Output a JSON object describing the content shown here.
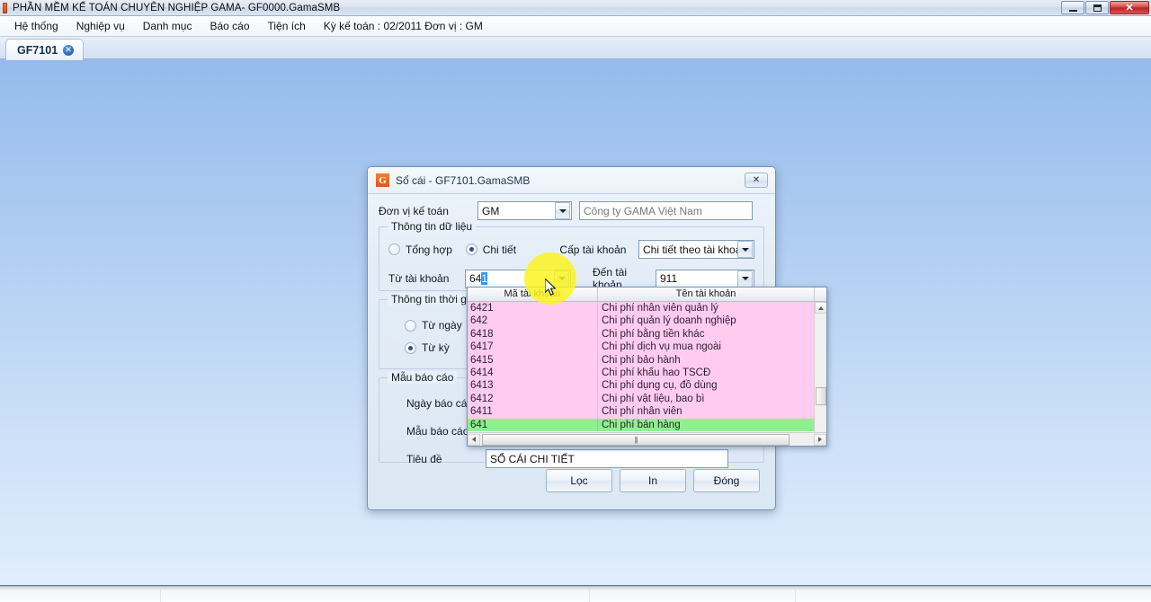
{
  "window": {
    "title": "PHẦN MỀM KẾ TOÁN CHUYÊN NGHIỆP GAMA- GF0000.GamaSMB",
    "minimize_label": "",
    "maximize_label": "",
    "close_label": "✕"
  },
  "menubar": {
    "items": [
      {
        "label": "Hệ thống"
      },
      {
        "label": "Nghiệp vụ"
      },
      {
        "label": "Danh mục"
      },
      {
        "label": "Báo cáo"
      },
      {
        "label": "Tiện ích"
      }
    ],
    "status": "Kỳ kế toán : 02/2011 Đơn vị : GM"
  },
  "tabs": [
    {
      "label": "GF7101",
      "close": "✕"
    }
  ],
  "dialog": {
    "logo_text": "G",
    "title": "Sổ cái - GF7101.GamaSMB",
    "close_label": "✕",
    "unit_label": "Đơn vị kế toán",
    "unit_value": "GM",
    "unit_name": "Công ty GAMA Việt Nam",
    "data_group_caption": "Thông tin dữ liệu",
    "radio_summary": "Tổng hợp",
    "radio_detail": "Chi tiết",
    "level_label": "Cấp tài khoản",
    "level_value": "Chi tiết theo tài khoản",
    "from_account_label": "Từ tài khoản",
    "from_account_value": "64",
    "from_account_selected": "1",
    "to_account_label": "Đến tài khoản",
    "to_account_value": "911",
    "time_group_caption": "Thông tin thời gian",
    "radio_from_date": "Từ ngày",
    "radio_from_period": "Từ kỳ",
    "report_group_caption": "Mẫu báo cáo",
    "report_date_label": "Ngày báo cáo",
    "report_template_label": "Mẫu báo cáo",
    "title_label": "Tiêu đề",
    "title_value": "SỔ CÁI CHI TIẾT",
    "buttons": [
      {
        "label": "Lọc"
      },
      {
        "label": "In"
      },
      {
        "label": "Đóng"
      }
    ]
  },
  "account_dropdown": {
    "columns": [
      "Mã tài khoản",
      "Tên tài khoản"
    ],
    "selected_index": 0,
    "rows": [
      {
        "code": "641",
        "name": "Chi phí bán hàng"
      },
      {
        "code": "6411",
        "name": "Chi phí nhân viên"
      },
      {
        "code": "6412",
        "name": "Chi phí vật liệu, bao bì"
      },
      {
        "code": "6413",
        "name": "Chi phí dụng cụ, đồ dùng"
      },
      {
        "code": "6414",
        "name": "Chi phí khấu hao TSCĐ"
      },
      {
        "code": "6415",
        "name": "Chi phí bảo hành"
      },
      {
        "code": "6417",
        "name": "Chi phí dịch vụ mua ngoài"
      },
      {
        "code": "6418",
        "name": "Chi phí bằng tiền khác"
      },
      {
        "code": "642",
        "name": "Chi phí quản lý doanh nghiệp"
      },
      {
        "code": "6421",
        "name": "Chi phí nhân viên quản lý"
      }
    ]
  },
  "colors": {
    "row_selected": "#8ff08f",
    "row_normal": "#ffccf0",
    "highlight": "#fcf321",
    "accent": "#e2541b"
  }
}
